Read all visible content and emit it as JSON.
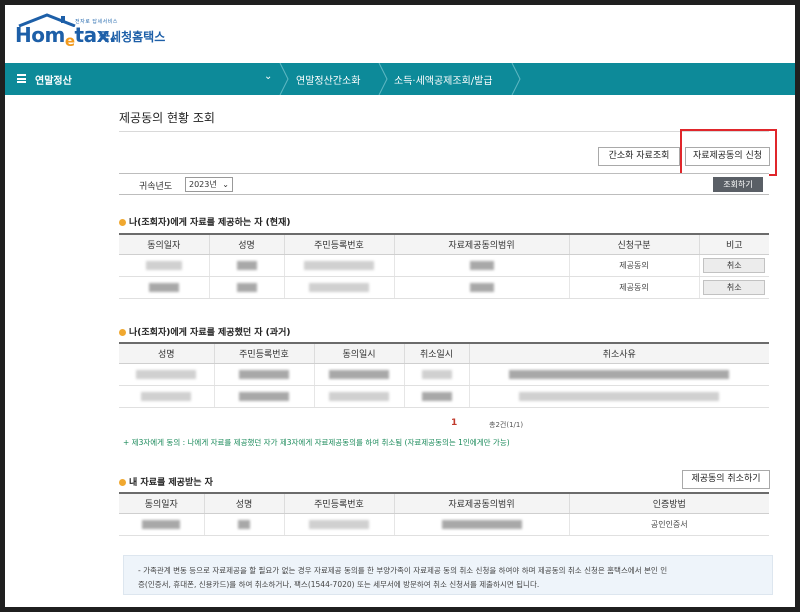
{
  "header": {
    "tagline": "전자로 답세서비스",
    "brand": "Hometax",
    "brand_e": "e",
    "agency": "국세청홈택스"
  },
  "nav": {
    "title": "연말정산",
    "items": [
      "연말정산간소화",
      "소득·세액공제조회/발급"
    ]
  },
  "page": {
    "title": "제공동의 현황 조회",
    "btn_simple_query": "간소화 자료조회",
    "btn_apply": "자료제공동의 신청",
    "filter_label": "귀속년도",
    "filter_year": "2023년",
    "btn_search": "조회하기"
  },
  "section1": {
    "title": "나(조회자)에게 자료를 제공하는 자 (현재)",
    "headers": [
      "동의일자",
      "성명",
      "주민등록번호",
      "자료제공동의범위",
      "신청구분",
      "비고"
    ],
    "rows": [
      {
        "type": "제공동의",
        "action": "취소"
      },
      {
        "type": "제공동의",
        "action": "취소"
      }
    ]
  },
  "section2": {
    "title": "나(조회자)에게 자료를 제공했던 자 (과거)",
    "headers": [
      "성명",
      "주민등록번호",
      "동의일시",
      "취소일시",
      "취소사유"
    ],
    "page_num": "1",
    "count": "총2건(1/1)",
    "note": "+ 제3자에게 동의 : 나에게 자료를 제공했던 자가 제3자에게 자료제공동의를 하여 취소됨 (자료제공동의는 1인에게만 가능)"
  },
  "section3": {
    "title": "내 자료를 제공받는 자",
    "btn_cancel": "제공동의 취소하기",
    "headers": [
      "동의일자",
      "성명",
      "주민등록번호",
      "자료제공동의범위",
      "인증방법"
    ],
    "rows": [
      {
        "auth": "공인인증서"
      }
    ]
  },
  "notice": {
    "line1": "- 가족관계 변동 등으로 자료제공을 할 필요가 없는 경우 자료제공 동의를 한 부양가족이 자료제공 동의 취소 신청을 하여야 하며 제공동의 취소 신청은 홈택스에서 본인 인",
    "line2": "증(인증서, 휴대폰, 신용카드)를 하여 취소하거나, 팩스(1544-7020) 또는 세무서에 방문하여 취소 신청서를 제출하시면 됩니다."
  }
}
